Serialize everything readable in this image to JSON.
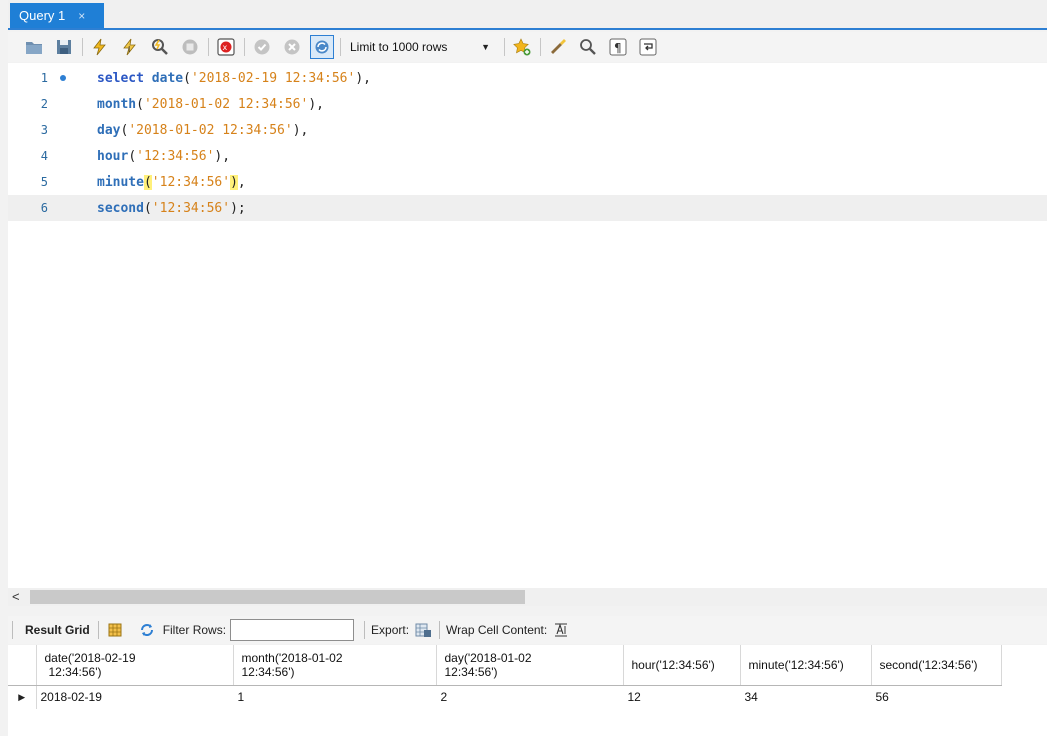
{
  "tab": {
    "title": "Query 1",
    "close_glyph": "×"
  },
  "toolbar": {
    "icons": [
      "open-folder-icon",
      "save-icon",
      "execute-icon",
      "execute-current-icon",
      "explain-icon",
      "stop-icon",
      "error-toggle-icon",
      "commit-icon",
      "rollback-icon",
      "autocommit-icon",
      "bookmark-icon",
      "beautify-icon",
      "find-icon",
      "invisible-chars-icon",
      "wrap-icon"
    ],
    "limit_label": "Limit to 1000 rows"
  },
  "editor": {
    "lines": [
      {
        "num": "1",
        "pre": "select ",
        "fn": "date",
        "open": "(",
        "arg": "'2018-02-19 12:34:56'",
        "close": ")",
        "end": ","
      },
      {
        "num": "2",
        "pre": "",
        "fn": "month",
        "open": "(",
        "arg": "'2018-01-02 12:34:56'",
        "close": ")",
        "end": ","
      },
      {
        "num": "3",
        "pre": "",
        "fn": "day",
        "open": "(",
        "arg": "'2018-01-02 12:34:56'",
        "close": ")",
        "end": ","
      },
      {
        "num": "4",
        "pre": "",
        "fn": "hour",
        "open": "(",
        "arg": "'12:34:56'",
        "close": ")",
        "end": ","
      },
      {
        "num": "5",
        "pre": "",
        "fn": "minute",
        "open": "(",
        "arg": "'12:34:56'",
        "close": ")",
        "end": ","
      },
      {
        "num": "6",
        "pre": "",
        "fn": "second",
        "open": "(",
        "arg": "'12:34:56'",
        "close": ")",
        "end": ";"
      }
    ]
  },
  "result_toolbar": {
    "result_grid_label": "Result Grid",
    "filter_label": "Filter Rows:",
    "filter_value": "",
    "export_label": "Export:",
    "wrap_label": "Wrap Cell Content:"
  },
  "grid": {
    "columns": [
      {
        "line1": "date('2018-02-19",
        "line2": "12:34:56')"
      },
      {
        "line1": "month('2018-01-02",
        "line2": "12:34:56')"
      },
      {
        "line1": "day('2018-01-02",
        "line2": "12:34:56')"
      },
      {
        "line1": "hour('12:34:56')",
        "line2": ""
      },
      {
        "line1": "minute('12:34:56')",
        "line2": ""
      },
      {
        "line1": "second('12:34:56')",
        "line2": ""
      }
    ],
    "rows": [
      [
        "2018-02-19",
        "1",
        "2",
        "12",
        "34",
        "56"
      ]
    ],
    "row_marker": "▶"
  },
  "colors": {
    "accent": "#1f7fd6",
    "keyword": "#2b57c4",
    "string": "#d6821a",
    "bracket_highlight": "#fff07a"
  }
}
